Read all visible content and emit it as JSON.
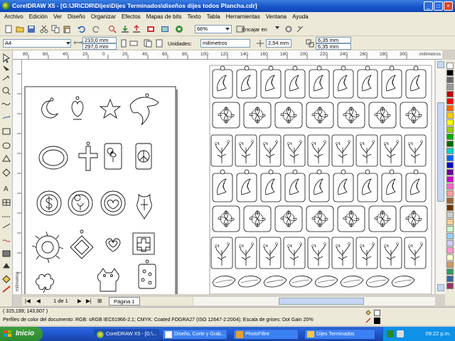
{
  "window": {
    "title": "CorelDRAW X5 - [G:\\JR\\CDR\\Dijes\\Dijes Terminados\\diseños dijes todos Plancha.cdr]",
    "min": "_",
    "max": "□",
    "close": "×"
  },
  "menu": [
    "Archivo",
    "Edición",
    "Ver",
    "Diseño",
    "Organizar",
    "Efectos",
    "Mapas de bits",
    "Texto",
    "Tabla",
    "Herramientas",
    "Ventana",
    "Ayuda"
  ],
  "toolbar": {
    "zoom": "66%",
    "snap": "Encajar en"
  },
  "propbar": {
    "paper": "A4",
    "width": "210,0 mm",
    "height": "297,0 mm",
    "units_label": "Unidades:",
    "units": "milímetros",
    "nudge": "2,54 mm",
    "dup_x": "6,35 mm",
    "dup_y": "6,35 mm"
  },
  "rulers": {
    "h": [
      "80",
      "60",
      "40",
      "20",
      "0",
      "20",
      "40",
      "60",
      "80",
      "100",
      "120",
      "140",
      "160",
      "180",
      "200",
      "220",
      "240",
      "260",
      "280",
      "300"
    ],
    "unit": "milímetros",
    "v_unit": "milímetros"
  },
  "pagenav": {
    "counter": "1 de 1",
    "tab": "Página 1"
  },
  "status": {
    "coords": "( 315,199; 143,607 )",
    "profile": "Perfiles de color del documento: RGB: sRGB IEC61966-2.1; CMYK: Coated FOGRA27 (ISO 12647-2:2004); Escala de grises: Dot Gain 20%"
  },
  "taskbar": {
    "start": "Inicio",
    "tasks": [
      "CorelDRAW X5 - [G:\\...",
      "Diseño, Corte y Grab...",
      "PhotoFiltre",
      "Dijes Terminados"
    ],
    "clock": "09:22 p.m."
  },
  "palette": [
    "#ffffff",
    "#000000",
    "#666666",
    "#999999",
    "#c00000",
    "#ff0000",
    "#ff6600",
    "#ffcc00",
    "#ffff00",
    "#99cc00",
    "#00aa00",
    "#006600",
    "#00cccc",
    "#0066ff",
    "#0000cc",
    "#660099",
    "#cc00cc",
    "#ff66cc",
    "#ff9999",
    "#996633",
    "#663300",
    "#cccccc",
    "#ffcc99",
    "#ccffcc",
    "#99ccff",
    "#ccccff",
    "#ff99cc",
    "#ffffcc",
    "#cc9966",
    "#339966",
    "#336699",
    "#993366"
  ]
}
